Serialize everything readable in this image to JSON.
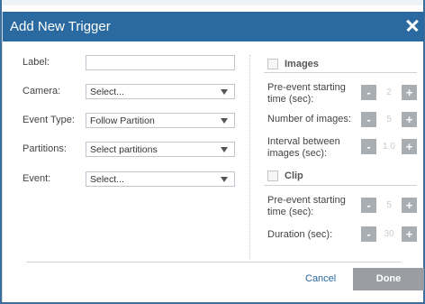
{
  "dialog": {
    "title": "Add New Trigger"
  },
  "left_form": {
    "label": {
      "label": "Label:",
      "value": ""
    },
    "camera": {
      "label": "Camera:",
      "value": "Select..."
    },
    "event_type": {
      "label": "Event Type:",
      "value": "Follow Partition"
    },
    "partitions": {
      "label": "Partitions:",
      "value": "Select partitions"
    },
    "event": {
      "label": "Event:",
      "value": "Select..."
    }
  },
  "images": {
    "title": "Images",
    "pre_event": {
      "label_line1": "Pre-event starting",
      "label_line2": "time (sec):",
      "value": "2"
    },
    "num_images": {
      "label": "Number of images:",
      "value": "5"
    },
    "interval": {
      "label_line1": "Interval between",
      "label_line2": "images (sec):",
      "value": "1.0"
    }
  },
  "clip": {
    "title": "Clip",
    "pre_event": {
      "label_line1": "Pre-event starting",
      "label_line2": "time (sec):",
      "value": "5"
    },
    "duration": {
      "label": "Duration (sec):",
      "value": "30"
    }
  },
  "stepper": {
    "minus": "-",
    "plus": "+"
  },
  "footer": {
    "cancel_label": "Cancel",
    "done_label": "Done"
  },
  "colors": {
    "titlebar": "#2a6aa0",
    "stepper_button": "#a9aeb3",
    "done_button": "#9a9ea3",
    "link": "#2a6aa0"
  }
}
